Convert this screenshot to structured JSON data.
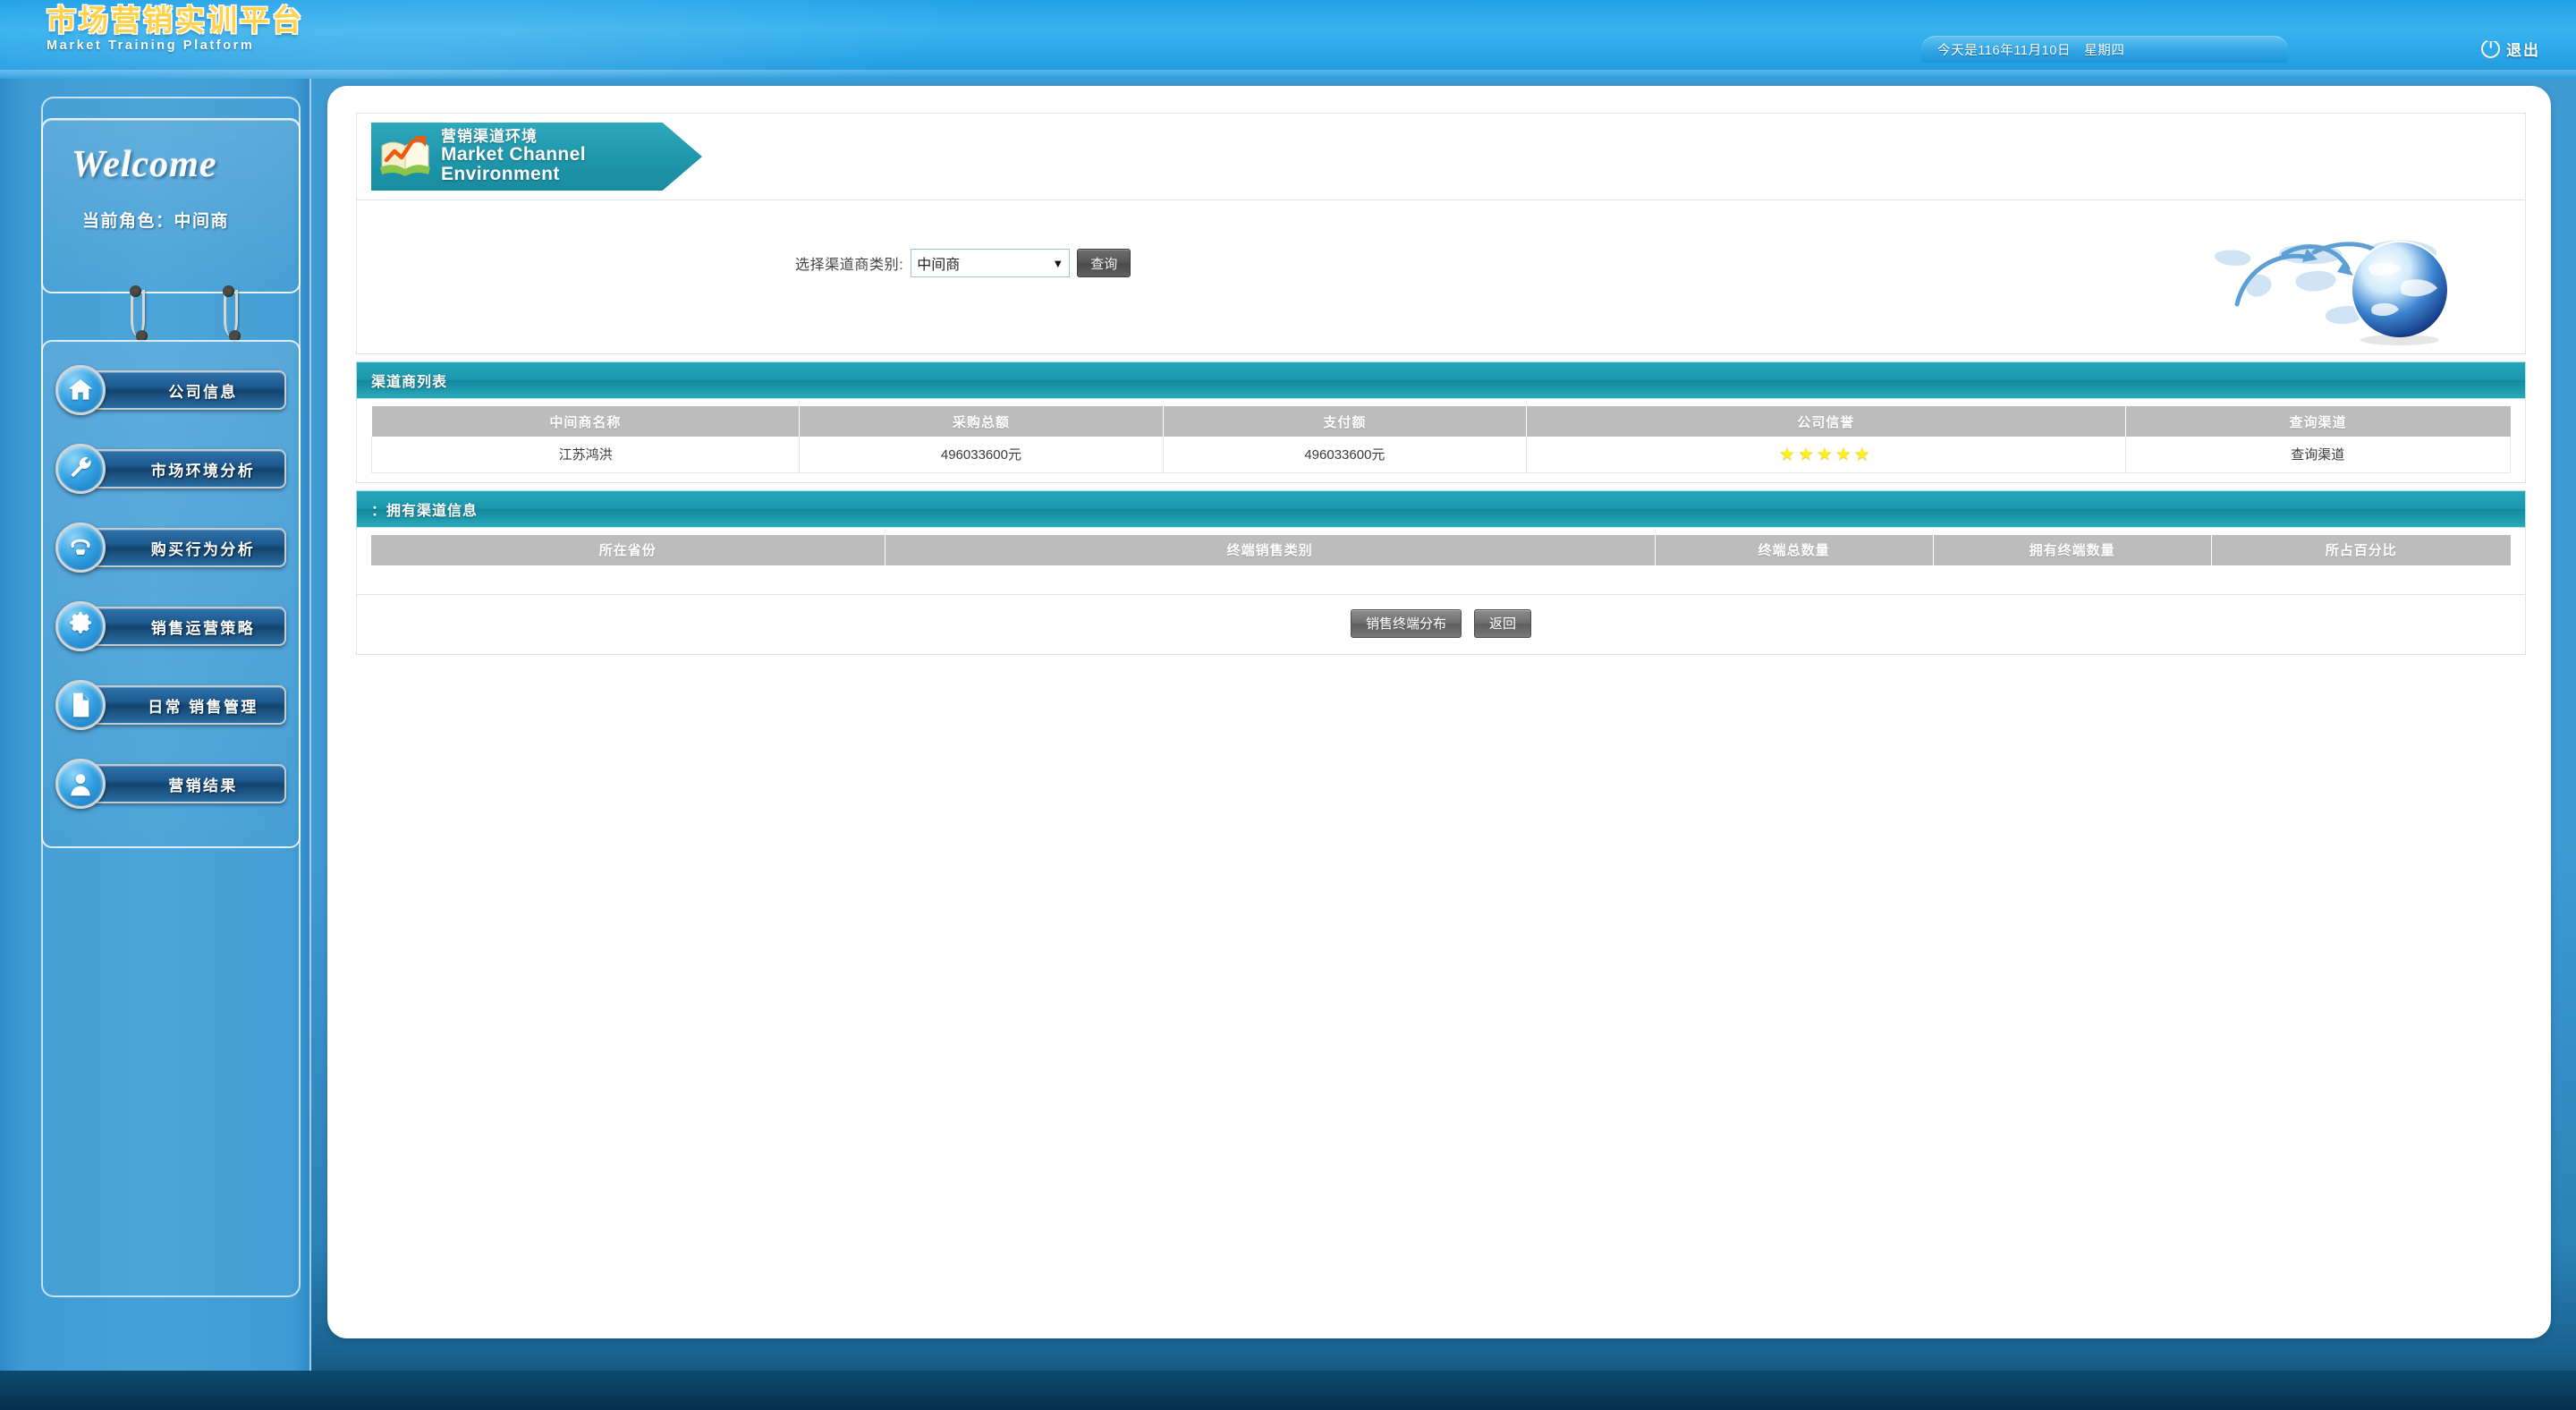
{
  "header": {
    "logo_cn": "市场营销实训平台",
    "logo_en": "Market Training Platform",
    "date_text": "今天是116年11月10日　星期四",
    "logout_label": "退出",
    "logout_icon": "power-icon"
  },
  "sidebar": {
    "welcome_title": "Welcome",
    "role_text": "当前角色：中间商",
    "items": [
      {
        "label": "公司信息",
        "icon": "home-icon"
      },
      {
        "label": "市场环境分析",
        "icon": "wrench-icon"
      },
      {
        "label": "购买行为分析",
        "icon": "phone-icon"
      },
      {
        "label": "销售运营策略",
        "icon": "gear-icon"
      },
      {
        "label": "日常 销售管理",
        "icon": "document-icon"
      },
      {
        "label": "营销结果",
        "icon": "user-icon"
      }
    ]
  },
  "page_banner": {
    "title_cn": "营销渠道环境",
    "title_en_line1": "Market Channel",
    "title_en_line2": "Environment",
    "icon": "book-chart-icon"
  },
  "filter": {
    "label": "选择渠道商类别:",
    "selected_value": "中间商",
    "caret": "▼",
    "query_button": "查询",
    "decor_icon": "globe-world-map-icon"
  },
  "channel_list": {
    "section_title": "渠道商列表",
    "columns": [
      "中间商名称",
      "采购总额",
      "支付额",
      "公司信誉",
      "查询渠道"
    ],
    "rows": [
      {
        "name": "江苏鸿洪",
        "purchase_total": "496033600元",
        "payment_total": "496033600元",
        "credit_stars": 5,
        "credit_glyph": "★★★★★",
        "query_link": "查询渠道"
      }
    ]
  },
  "owned_channels": {
    "section_title": "：拥有渠道信息",
    "columns": [
      "所在省份",
      "终端销售类别",
      "终端总数量",
      "拥有终端数量",
      "所占百分比"
    ],
    "rows": []
  },
  "actions": {
    "distribution_button": "销售终端分布",
    "back_button": "返回"
  },
  "colors": {
    "banner_blue": "#2ba5e6",
    "sidebar_blue": "#3f9bd4",
    "teal_bar": "#1a97ab",
    "table_header_grey": "#bcbcbc",
    "star_yellow": "#ffef12",
    "logo_gold": "#ffcb34"
  }
}
